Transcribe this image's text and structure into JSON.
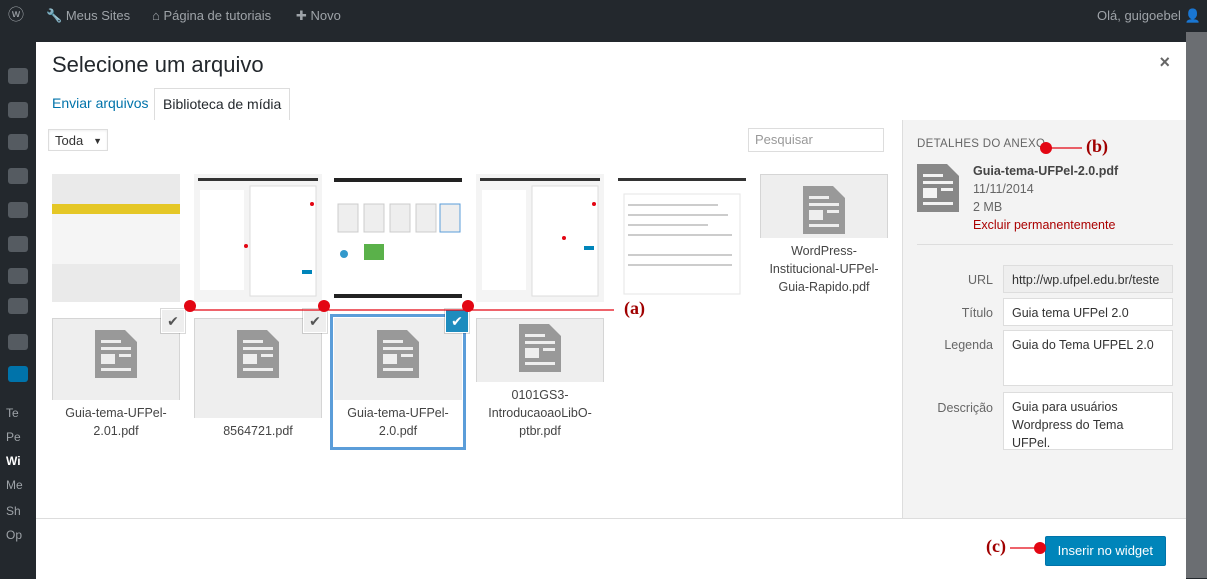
{
  "adminbar": {
    "my_sites": "Meus Sites",
    "site_name": "Página de tutoriais",
    "new": "Novo",
    "greeting": "Olá, guigoebel"
  },
  "sidebar": {
    "letters": [
      "Te",
      "Pe",
      "Wi",
      "Me",
      "Sh",
      "Op"
    ]
  },
  "modal": {
    "title": "Selecione um arquivo",
    "close": "×",
    "tabs": [
      "Enviar arquivos",
      "Biblioteca de mídia"
    ],
    "filter_value": "Toda",
    "search_placeholder": "Pesquisar"
  },
  "attachments": [
    {
      "filename": ""
    },
    {
      "filename": ""
    },
    {
      "filename": ""
    },
    {
      "filename": ""
    },
    {
      "filename": ""
    },
    {
      "filename": "WordPress-Institucional-UFPel-Guia-Rapido.pdf"
    },
    {
      "filename": "Guia-tema-UFPel-2.01.pdf"
    },
    {
      "filename": "8564721.pdf"
    },
    {
      "filename": "Guia-tema-UFPel-2.0.pdf"
    },
    {
      "filename": "0101GS3-IntroducaoaoLibO-ptbr.pdf"
    }
  ],
  "details": {
    "heading": "DETALHES DO ANEXO",
    "filename": "Guia-tema-UFPel-2.0.pdf",
    "date": "11/11/2014",
    "size": "2 MB",
    "delete": "Excluir permanentemente",
    "fields": {
      "url_label": "URL",
      "url_value": "http://wp.ufpel.edu.br/teste",
      "title_label": "Título",
      "title_value": "Guia tema UFPel 2.0",
      "caption_label": "Legenda",
      "caption_value": "Guia do Tema UFPEL 2.0",
      "desc_label": "Descrição",
      "desc_value": "Guia para usuários Wordpress do Tema UFPel."
    }
  },
  "toolbar": {
    "insert": "Inserir no widget"
  },
  "annotations": {
    "a": "(a)",
    "b": "(b)",
    "c": "(c)",
    "color": "#e30613"
  },
  "colors": {
    "accent": "#0085ba",
    "selection": "#5b9dd9",
    "delete": "#a00"
  }
}
